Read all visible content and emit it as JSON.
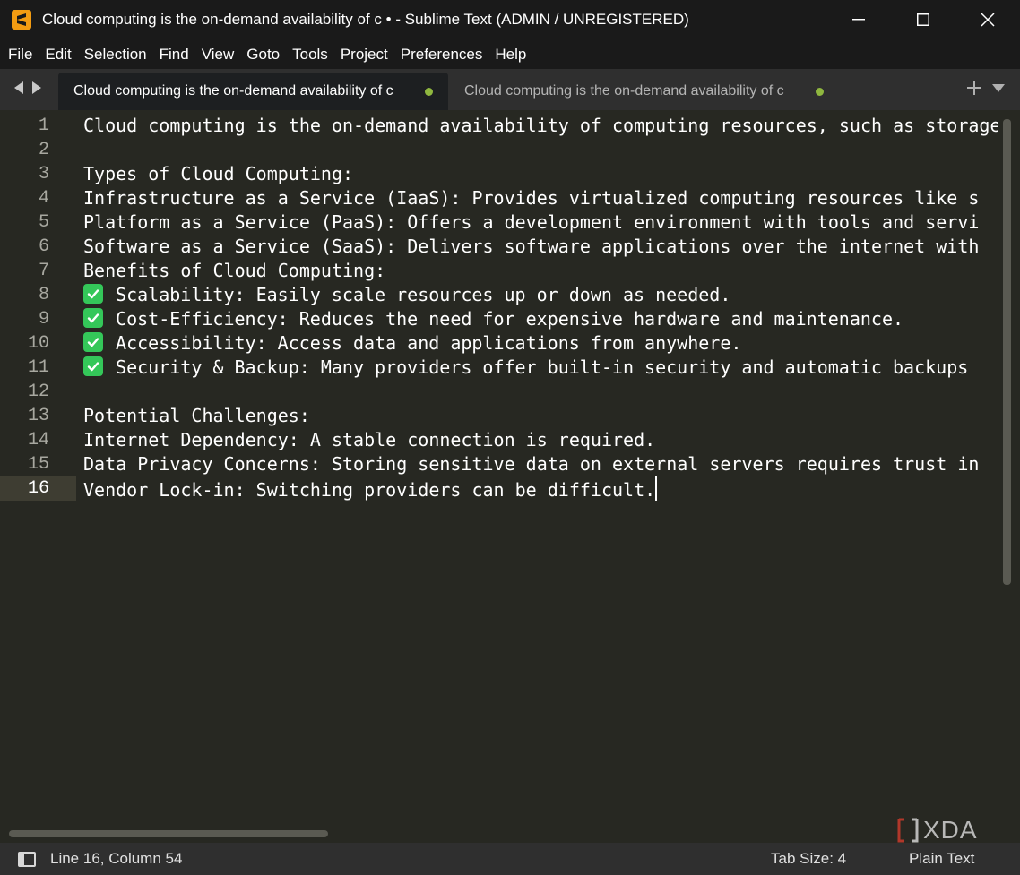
{
  "window": {
    "title": "Cloud computing is the on-demand availability of c • - Sublime Text (ADMIN / UNREGISTERED)",
    "app_icon": "sublime-text-icon"
  },
  "menu": [
    "File",
    "Edit",
    "Selection",
    "Find",
    "View",
    "Goto",
    "Tools",
    "Project",
    "Preferences",
    "Help"
  ],
  "tabs": [
    {
      "label": "Cloud computing is the on-demand availability of c",
      "active": true,
      "modified": true
    },
    {
      "label": "Cloud computing is the on-demand availability of c",
      "active": false,
      "modified": true
    }
  ],
  "editor": {
    "current_line": 16,
    "lines": [
      {
        "n": "1",
        "check": false,
        "text": "Cloud computing is the on-demand availability of computing resources, such as storage"
      },
      {
        "n": "2",
        "check": false,
        "text": ""
      },
      {
        "n": "3",
        "check": false,
        "text": "Types of Cloud Computing:"
      },
      {
        "n": "4",
        "check": false,
        "text": "Infrastructure as a Service (IaaS): Provides virtualized computing resources like s"
      },
      {
        "n": "5",
        "check": false,
        "text": "Platform as a Service (PaaS): Offers a development environment with tools and servi"
      },
      {
        "n": "6",
        "check": false,
        "text": "Software as a Service (SaaS): Delivers software applications over the internet with"
      },
      {
        "n": "7",
        "check": false,
        "text": "Benefits of Cloud Computing:"
      },
      {
        "n": "8",
        "check": true,
        "text": " Scalability: Easily scale resources up or down as needed."
      },
      {
        "n": "9",
        "check": true,
        "text": " Cost-Efficiency: Reduces the need for expensive hardware and maintenance."
      },
      {
        "n": "10",
        "check": true,
        "text": " Accessibility: Access data and applications from anywhere."
      },
      {
        "n": "11",
        "check": true,
        "text": " Security & Backup: Many providers offer built-in security and automatic backups"
      },
      {
        "n": "12",
        "check": false,
        "text": ""
      },
      {
        "n": "13",
        "check": false,
        "text": "Potential Challenges:"
      },
      {
        "n": "14",
        "check": false,
        "text": "Internet Dependency: A stable connection is required."
      },
      {
        "n": "15",
        "check": false,
        "text": "Data Privacy Concerns: Storing sensitive data on external servers requires trust in"
      },
      {
        "n": "16",
        "check": false,
        "text": "Vendor Lock-in: Switching providers can be difficult."
      }
    ]
  },
  "status": {
    "position": "Line 16, Column 54",
    "tab_size": "Tab Size: 4",
    "syntax": "Plain Text"
  },
  "watermark": {
    "text": "XDA"
  }
}
